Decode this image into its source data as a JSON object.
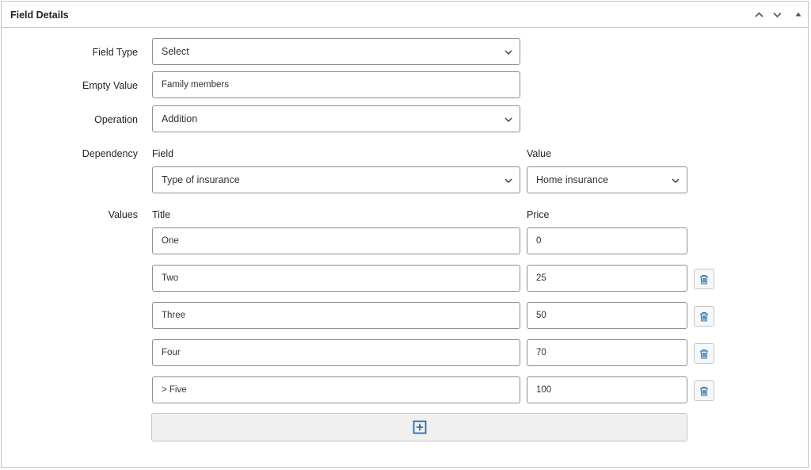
{
  "panel": {
    "title": "Field Details",
    "controls": [
      "chevron-up-icon",
      "chevron-down-icon",
      "triangle-up-icon"
    ]
  },
  "form": {
    "field_type": {
      "label": "Field Type",
      "value": "Select"
    },
    "empty_value": {
      "label": "Empty Value",
      "value": "Family members"
    },
    "operation": {
      "label": "Operation",
      "value": "Addition"
    },
    "dependency": {
      "label": "Dependency",
      "field_header": "Field",
      "value_header": "Value",
      "field_value": "Type of insurance",
      "value_value": "Home insurance"
    },
    "values": {
      "label": "Values",
      "title_header": "Title",
      "price_header": "Price",
      "rows": [
        {
          "title": "One",
          "price": "0"
        },
        {
          "title": "Two",
          "price": "25"
        },
        {
          "title": "Three",
          "price": "50"
        },
        {
          "title": "Four",
          "price": "70"
        },
        {
          "title": "> Five",
          "price": "100"
        }
      ]
    }
  },
  "colors": {
    "accent": "#2271b1",
    "border": "#8c8f94",
    "panel_border": "#c3c4c7",
    "add_bar_bg": "#f0f0f1",
    "text": "#1d2327"
  },
  "icons": {
    "add": "plus-square-icon",
    "delete": "trash-icon",
    "dropdown": "chevron-down-icon"
  }
}
